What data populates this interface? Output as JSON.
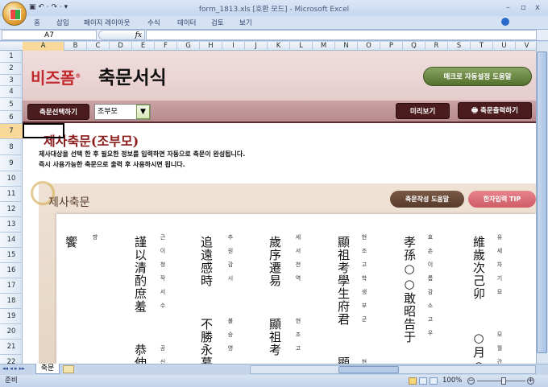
{
  "window": {
    "title": "form_1813.xls  [호환 모드] - Microsoft Excel",
    "min": "–",
    "max": "▫",
    "close": "x",
    "qat": "▣ ↶ · ↷ · ▾"
  },
  "ribbon": {
    "tabs": [
      "홈",
      "삽입",
      "페이지 레이아웃",
      "수식",
      "데이터",
      "검토",
      "보기"
    ]
  },
  "formula": {
    "name_box": "A7",
    "fx": "fx",
    "value": ""
  },
  "columns": [
    "A",
    "B",
    "C",
    "D",
    "E",
    "F",
    "G",
    "H",
    "I",
    "J",
    "K",
    "L",
    "M",
    "N",
    "O",
    "P",
    "Q",
    "R",
    "S",
    "T",
    "U",
    "V"
  ],
  "rows": [
    "1",
    "2",
    "3",
    "4",
    "5",
    "6",
    "7",
    "8",
    "9",
    "10",
    "11",
    "12",
    "13",
    "14",
    "15",
    "16",
    "17",
    "18",
    "19",
    "20",
    "21",
    "22"
  ],
  "banner": {
    "logo": "비즈폼",
    "reg": "®",
    "app_title": "축문서식",
    "macro_help": "매크로 자동설정 도움말"
  },
  "toolbar": {
    "select": "축문선택하기",
    "combo_value": "조부모",
    "preview": "미리보기",
    "print": "축문출력하기"
  },
  "content": {
    "heading": "제사축문(조부모)",
    "desc1": "제사대상을 선택 한 후 필요한 정보를 입력하면 자동으로 축문이 완성됩니다.",
    "desc2": "즉시 사용가능한 축문으로 출력 후 사용하시면 됩니다."
  },
  "panel": {
    "title": "제사축문",
    "help": "축문작성 도움말",
    "tip": "한자입력 TIP"
  },
  "chukmun": [
    {
      "hanja": "維歲次己卯  ○月○",
      "hangul": "유세차기묘  모월간"
    },
    {
      "hanja": "孝孫○○敢昭告于",
      "hangul": "효손이름감소고우"
    },
    {
      "hanja": "顯祖考學生府君  顯",
      "hangul": "현조고학생부군  현"
    },
    {
      "hanja": "歲序遷易  顯祖考",
      "hangul": "세서천역  현조고"
    },
    {
      "hanja": "追遠感時  不勝永慕",
      "hangul": "추원감시  불승영"
    },
    {
      "hanja": "謹以清酌庶羞  恭伸奠",
      "hangul": "근이청작서수  공신"
    },
    {
      "hanja": "饗",
      "hangul": "향"
    }
  ],
  "sheet_tabs": {
    "nav": "◂◂ ◂ ▸ ▸▸",
    "active": "축문"
  },
  "status": {
    "ready": "준비",
    "zoom": "100%"
  }
}
